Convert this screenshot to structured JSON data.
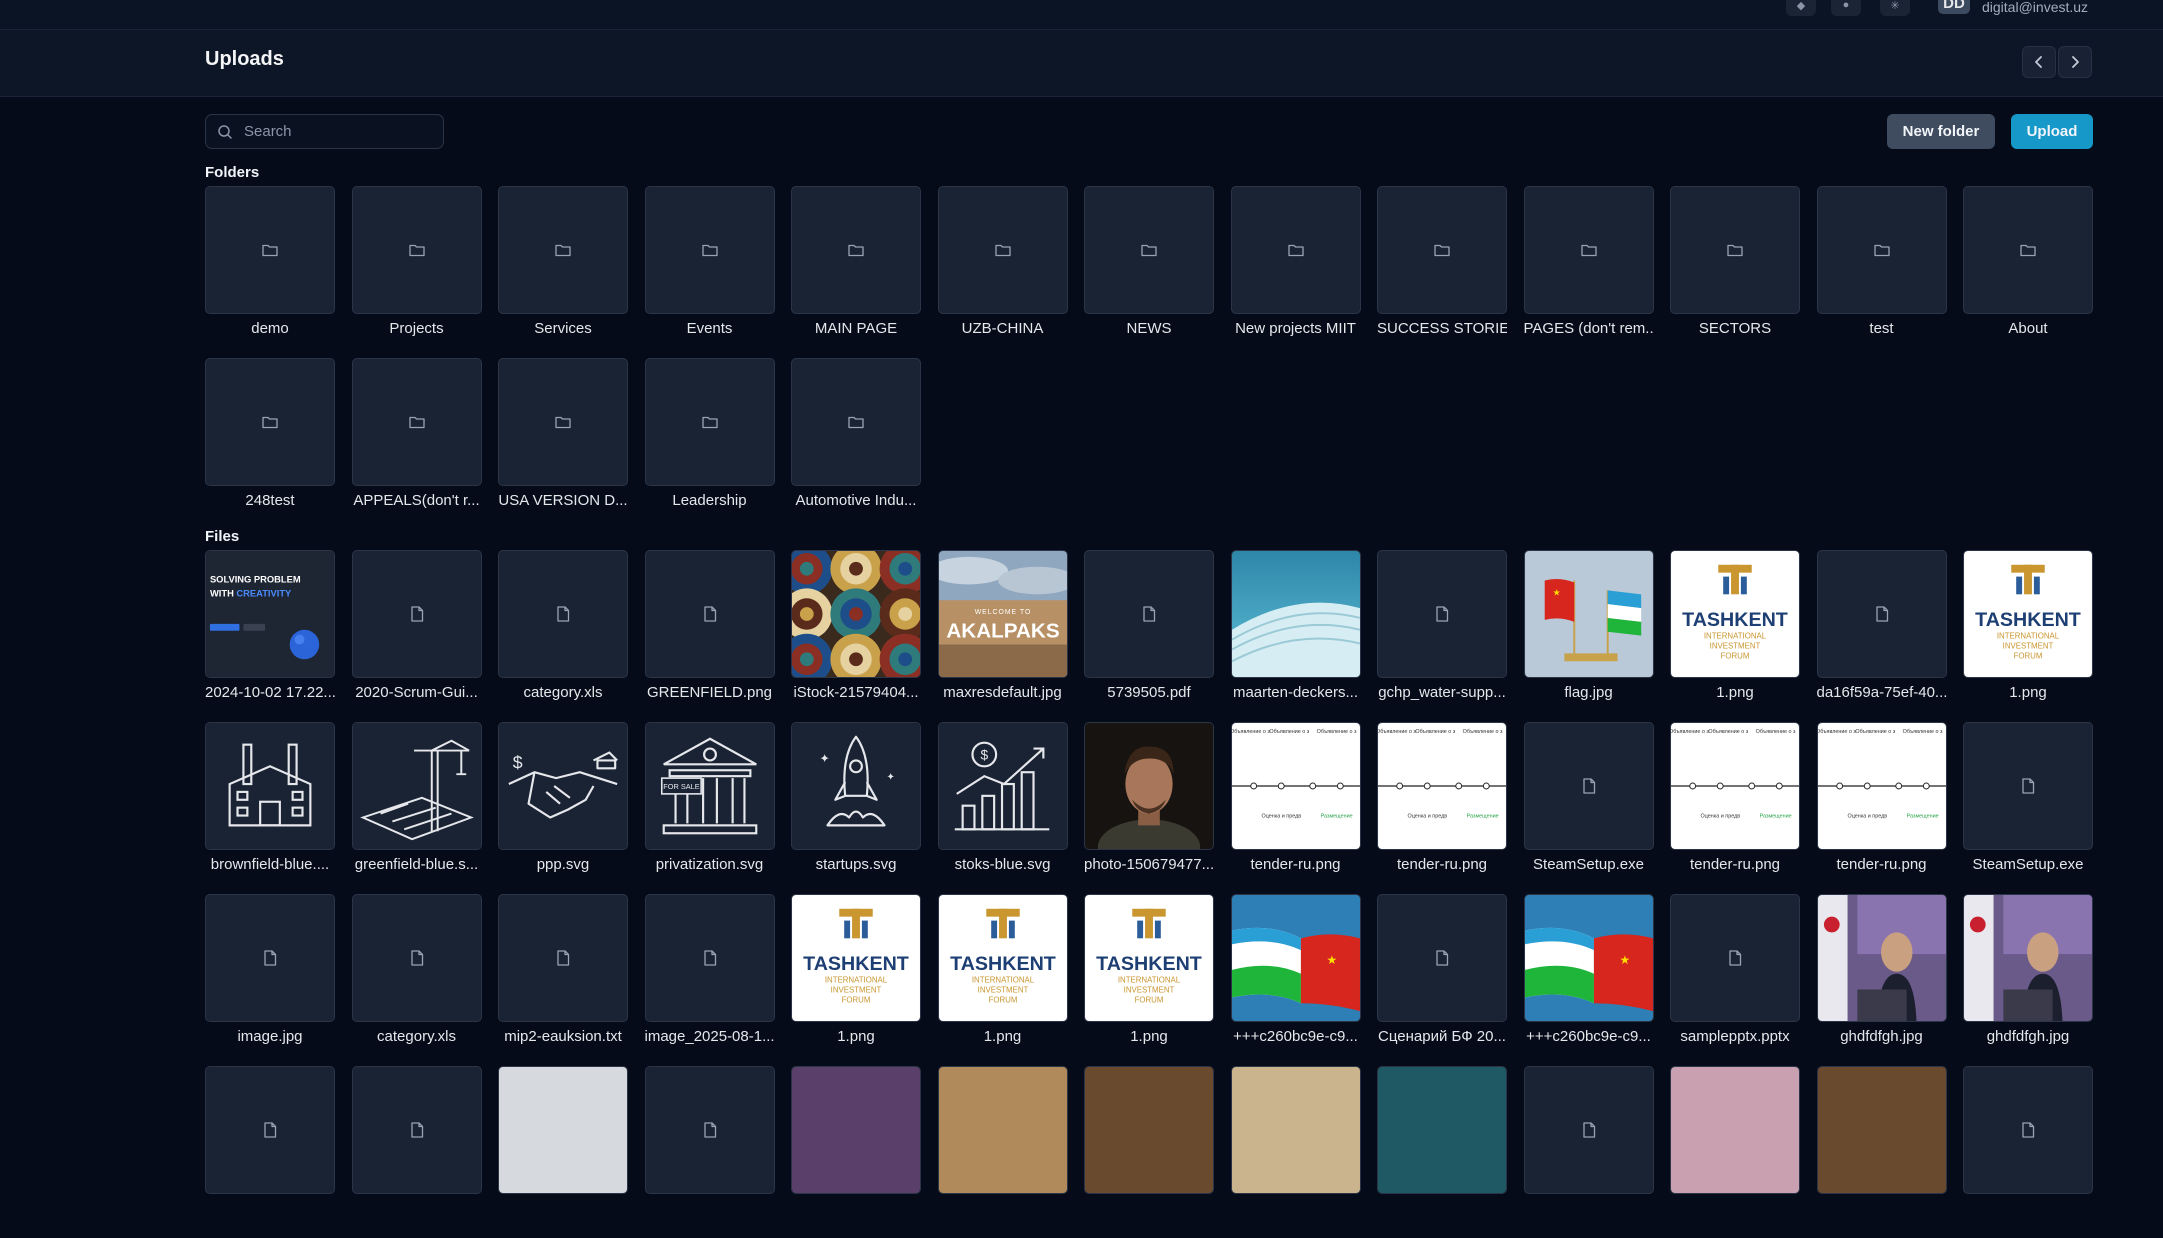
{
  "user": {
    "initials": "DD",
    "email": "digital@invest.uz"
  },
  "page": {
    "title": "Uploads"
  },
  "search": {
    "placeholder": "Search"
  },
  "actions": {
    "new_folder": "New folder",
    "upload": "Upload"
  },
  "sections": {
    "folders": "Folders",
    "files": "Files"
  },
  "folders": [
    "demo",
    "Projects",
    "Services",
    "Events",
    "MAIN PAGE",
    "UZB-CHINA",
    "NEWS",
    "New projects MIIT",
    "SUCCESS STORIES",
    "PAGES (don't rem...",
    "SECTORS",
    "test",
    "About",
    "248test",
    "APPEALS(don't r...",
    "USA VERSION D...",
    "Leadership",
    "Automotive Indu..."
  ],
  "files": [
    {
      "name": "2024-10-02 17.22....",
      "preview": "slide"
    },
    {
      "name": "2020-Scrum-Gui...",
      "preview": "generic"
    },
    {
      "name": "category.xls",
      "preview": "generic"
    },
    {
      "name": "GREENFIELD.png",
      "preview": "generic"
    },
    {
      "name": "iStock-21579404...",
      "preview": "mosaic"
    },
    {
      "name": "maxresdefault.jpg",
      "preview": "karakalpak"
    },
    {
      "name": "5739505.pdf",
      "preview": "generic"
    },
    {
      "name": "maarten-deckers...",
      "preview": "building"
    },
    {
      "name": "gchp_water-supp...",
      "preview": "generic"
    },
    {
      "name": "flag.jpg",
      "preview": "flags"
    },
    {
      "name": "1.png",
      "preview": "tashkent"
    },
    {
      "name": "da16f59a-75ef-40...",
      "preview": "generic"
    },
    {
      "name": "1.png",
      "preview": "tashkent"
    },
    {
      "name": "brownfield-blue....",
      "preview": "factory"
    },
    {
      "name": "greenfield-blue.s...",
      "preview": "crane"
    },
    {
      "name": "ppp.svg",
      "preview": "handshake"
    },
    {
      "name": "privatization.svg",
      "preview": "bank"
    },
    {
      "name": "startups.svg",
      "preview": "rocket"
    },
    {
      "name": "stoks-blue.svg",
      "preview": "stocks"
    },
    {
      "name": "photo-150679477...",
      "preview": "portrait"
    },
    {
      "name": "tender-ru.png",
      "preview": "tender"
    },
    {
      "name": "tender-ru.png",
      "preview": "tender"
    },
    {
      "name": "SteamSetup.exe",
      "preview": "generic"
    },
    {
      "name": "tender-ru.png",
      "preview": "tender"
    },
    {
      "name": "tender-ru.png",
      "preview": "tender"
    },
    {
      "name": "SteamSetup.exe",
      "preview": "generic"
    },
    {
      "name": "image.jpg",
      "preview": "generic"
    },
    {
      "name": "category.xls",
      "preview": "generic"
    },
    {
      "name": "mip2-eauksion.txt",
      "preview": "generic"
    },
    {
      "name": "image_2025-08-1...",
      "preview": "generic"
    },
    {
      "name": "1.png",
      "preview": "tashkent"
    },
    {
      "name": "1.png",
      "preview": "tashkent"
    },
    {
      "name": "1.png",
      "preview": "tashkent"
    },
    {
      "name": "+++c260bc9e-c9...",
      "preview": "uzcn"
    },
    {
      "name": "Сценарий БФ 20...",
      "preview": "generic"
    },
    {
      "name": "+++c260bc9e-c9...",
      "preview": "uzcn"
    },
    {
      "name": "samplepptx.pptx",
      "preview": "generic"
    },
    {
      "name": "ghdfdfgh.jpg",
      "preview": "speaker"
    },
    {
      "name": "ghdfdfgh.jpg",
      "preview": "speaker"
    }
  ],
  "partial_row_previews": [
    "generic",
    "generic",
    "light",
    "generic",
    "purple",
    "tan",
    "brown",
    "beige",
    "teal",
    "generic",
    "pink",
    "brown",
    "generic"
  ],
  "preview_text": {
    "slide_line1": "SOLVING PROBLEM",
    "slide_line2": "WITH",
    "slide_accent": "CREATIVITY",
    "karakalpak": "WELCOME TO",
    "karakalpak_big": "AKALPAKS",
    "tashkent_line1": "TASHKENT",
    "tashkent_line2": "INTERNATIONAL",
    "tashkent_line3": "INVESTMENT",
    "tashkent_line4": "FORUM",
    "for_sale": "FOR SALE",
    "tender_col1": "Объявление о запросе квалификации",
    "tender_col2": "Объявление о запросе предложений",
    "tender_col3": "Оценка и предварительный отбор участников тендера",
    "tender_col4": "Размещение"
  },
  "colors": {
    "accent": "#1698c9",
    "background": "#050b18",
    "tile": "#1a2334"
  }
}
